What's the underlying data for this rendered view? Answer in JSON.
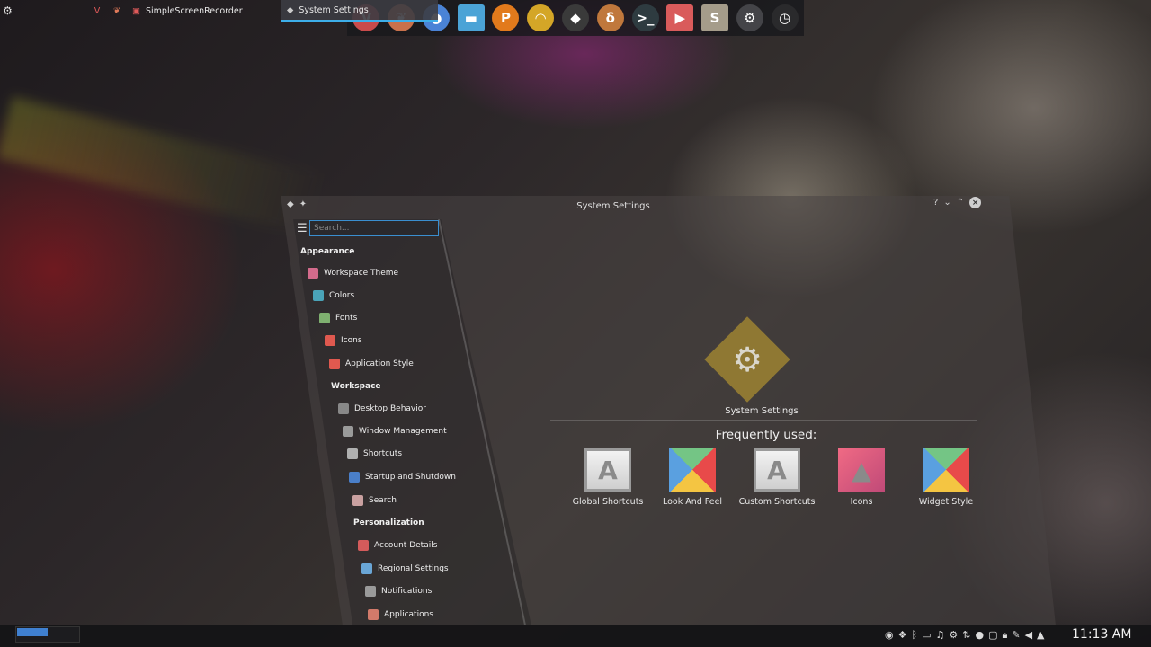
{
  "window": {
    "title": "System Settings"
  },
  "dock": {
    "items": [
      {
        "name": "vivaldi-icon",
        "glyph": "V",
        "color": "#c94b4b"
      },
      {
        "name": "vivaldi-alt-icon",
        "glyph": "❦",
        "color": "#c9714b"
      },
      {
        "name": "chromium-icon",
        "glyph": "●",
        "color": "#4a83d6"
      },
      {
        "name": "file-manager-icon",
        "glyph": "▬",
        "color": "#4ba3d6"
      },
      {
        "name": "p-app-icon",
        "glyph": "P",
        "color": "#e27a1c"
      },
      {
        "name": "gimp-icon",
        "glyph": "◠",
        "color": "#d4a627"
      },
      {
        "name": "inkscape-icon",
        "glyph": "◆",
        "color": "#3a3a3a"
      },
      {
        "name": "swirl-app-icon",
        "glyph": "δ",
        "color": "#c0783c"
      },
      {
        "name": "terminal-icon",
        "glyph": ">_",
        "color": "#2e3b40"
      },
      {
        "name": "recorder-icon",
        "glyph": "▶",
        "color": "#d95b5b"
      },
      {
        "name": "s-app-icon",
        "glyph": "S",
        "color": "#a59c8a"
      },
      {
        "name": "settings-icon",
        "glyph": "⚙",
        "color": "#444448"
      },
      {
        "name": "clock-icon",
        "glyph": "◷",
        "color": "#2a2a2c"
      }
    ]
  },
  "sidebar": {
    "search_placeholder": "Search...",
    "categories": {
      "appearance": "Appearance",
      "workspace": "Workspace",
      "personalization": "Personalization"
    },
    "items": [
      {
        "label": "Workspace Theme",
        "color": "#d36b8c"
      },
      {
        "label": "Colors",
        "color": "#4aa3b8"
      },
      {
        "label": "Fonts",
        "color": "#7fb070"
      },
      {
        "label": "Icons",
        "color": "#e0594f"
      },
      {
        "label": "Application Style",
        "color": "#e0594f"
      },
      {
        "label": "Desktop Behavior",
        "color": "#888888"
      },
      {
        "label": "Window Management",
        "color": "#9a9a9a"
      },
      {
        "label": "Shortcuts",
        "color": "#b0b0b0"
      },
      {
        "label": "Startup and Shutdown",
        "color": "#4a7fc9"
      },
      {
        "label": "Search",
        "color": "#c9a0a0"
      },
      {
        "label": "Account Details",
        "color": "#d45b5b"
      },
      {
        "label": "Regional Settings",
        "color": "#6aa6d6"
      },
      {
        "label": "Notifications",
        "color": "#9a9a9a"
      },
      {
        "label": "Applications",
        "color": "#d27a6a"
      }
    ]
  },
  "main": {
    "logo_label": "System Settings",
    "frequently_used_heading": "Frequently used:",
    "favorites": [
      {
        "label": "Global Shortcuts",
        "glyph": "A"
      },
      {
        "label": "Look And Feel",
        "glyph": ""
      },
      {
        "label": "Custom Shortcuts",
        "glyph": "A"
      },
      {
        "label": "Icons",
        "glyph": "▲"
      },
      {
        "label": "Widget Style",
        "glyph": ""
      }
    ]
  },
  "taskbar": {
    "tasks": [
      {
        "label": "SimpleScreenRecorder"
      },
      {
        "label": "System Settings"
      }
    ],
    "clock": "11:13 AM"
  }
}
